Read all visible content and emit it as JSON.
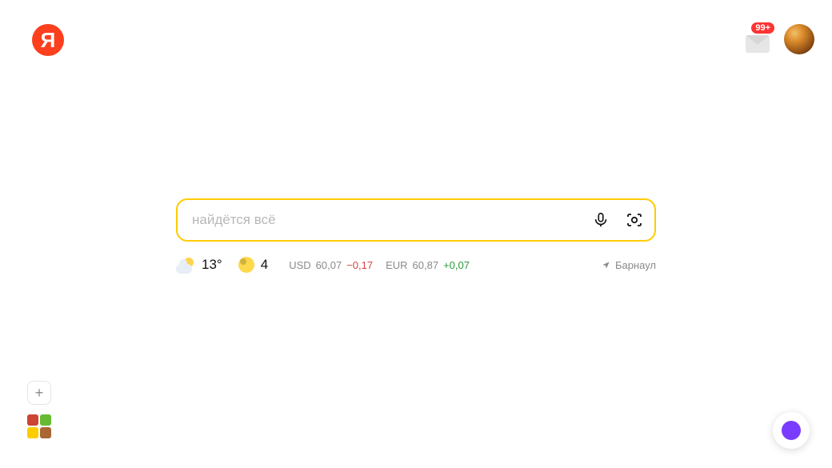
{
  "logo_letter": "Я",
  "mail_badge": "99+",
  "search": {
    "placeholder": "найдётся всё"
  },
  "weather": {
    "temp": "13°"
  },
  "traffic": {
    "level": "4"
  },
  "rates": {
    "usd_label": "USD",
    "usd_value": "60,07",
    "usd_delta": "−0,17",
    "eur_label": "EUR",
    "eur_value": "60,87",
    "eur_delta": "+0,07"
  },
  "location": "Барнаул"
}
